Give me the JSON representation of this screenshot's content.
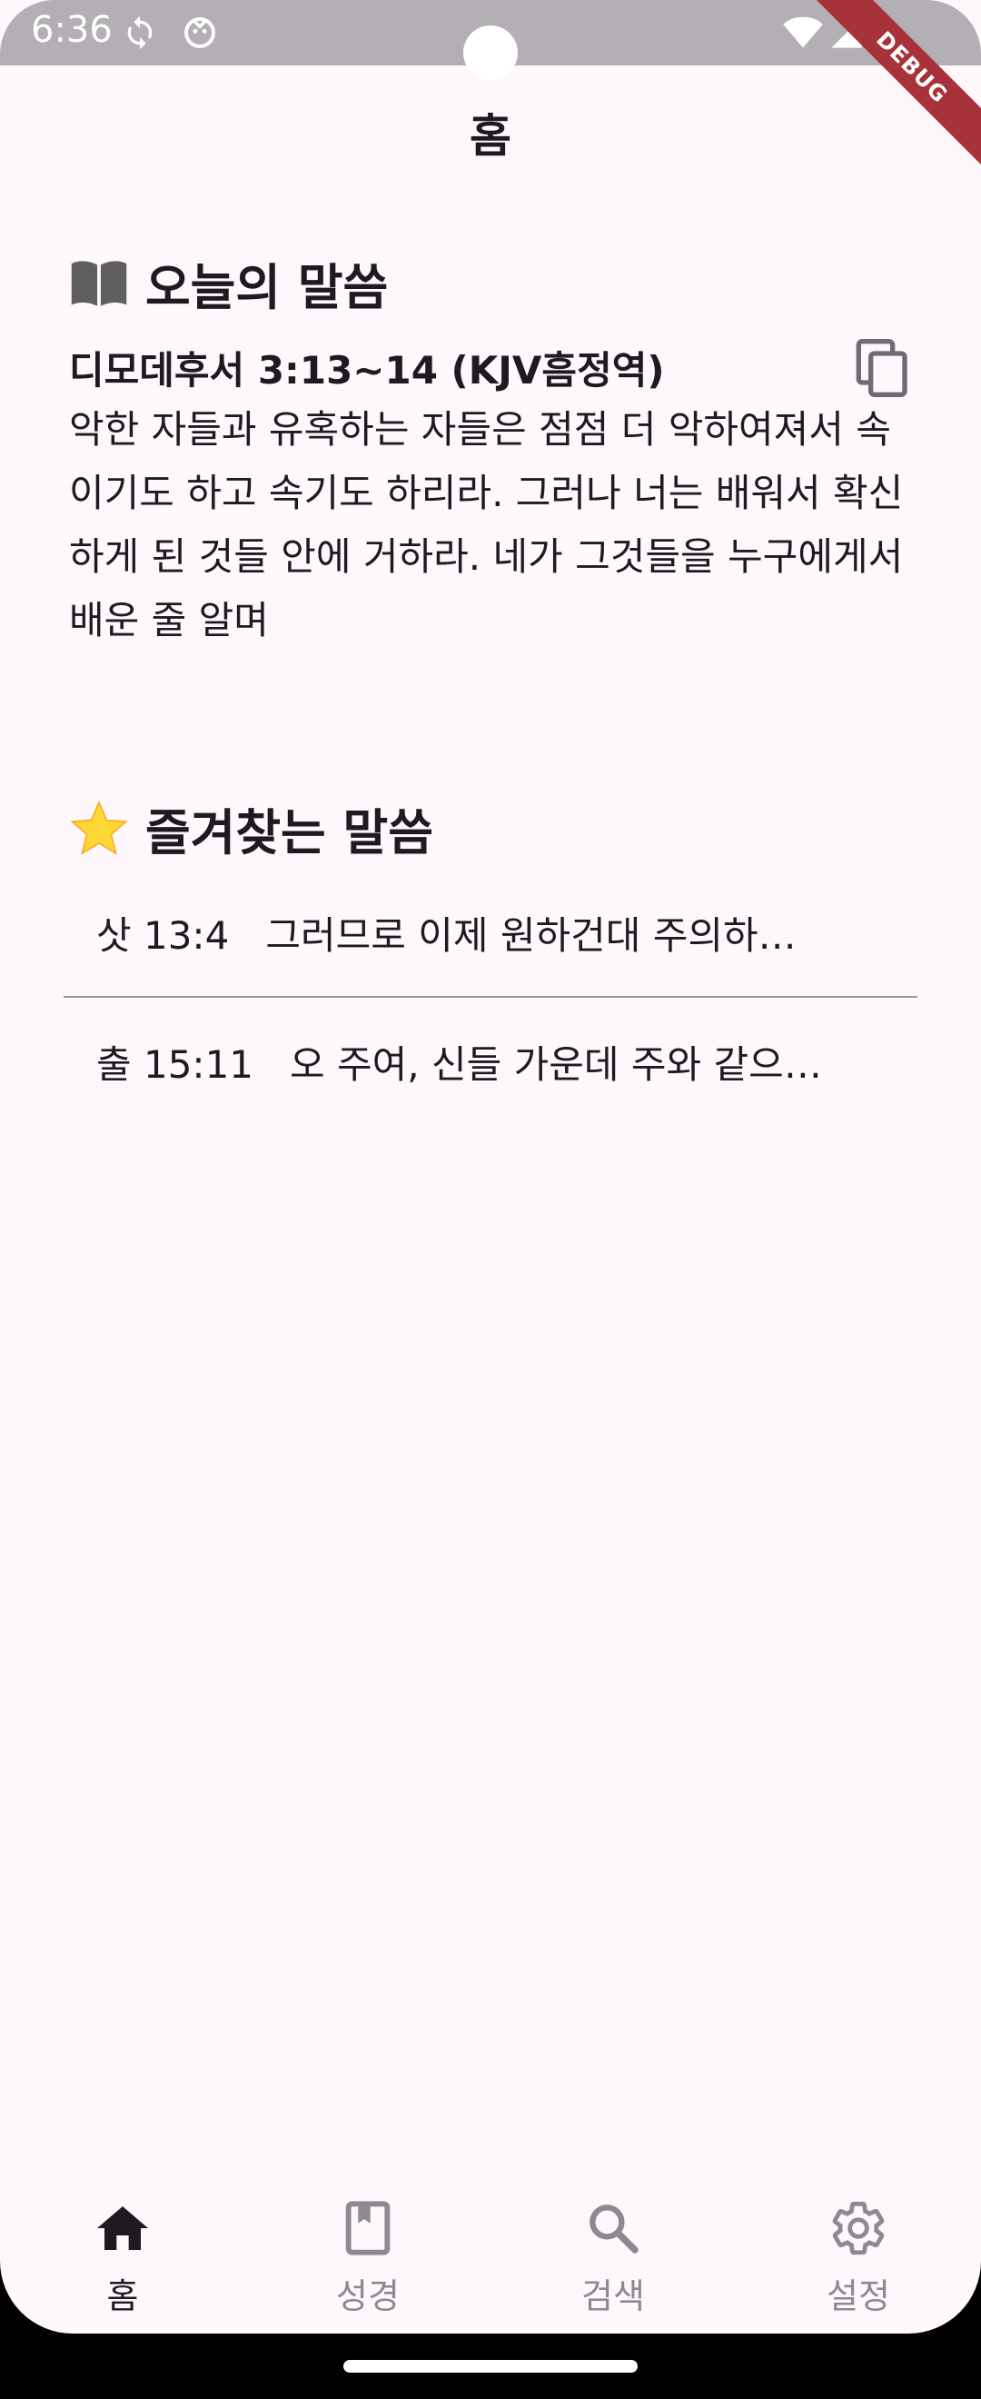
{
  "status_bar": {
    "time": "6:36",
    "debug_label": "DEBUG"
  },
  "app_bar": {
    "title": "홈"
  },
  "today_section": {
    "icon": "book-open-icon",
    "title": "오늘의 말씀",
    "reference": "디모데후서 3:13~14 (KJV흠정역)",
    "text": "악한 자들과 유혹하는 자들은 점점 더 악하여져서 속이기도 하고 속기도 하리라. 그러나 너는 배워서 확신하게 된 것들 안에 거하라. 네가 그것들을 누구에게서 배운 줄 알며"
  },
  "favorites_section": {
    "icon": "star-icon",
    "title": "즐겨찾는 말씀",
    "items": [
      {
        "ref": "삿 13:4",
        "text": "그러므로 이제 원하건대 주의하…"
      },
      {
        "ref": "출 15:11",
        "text": "오 주여, 신들 가운데 주와 같으…"
      }
    ]
  },
  "bottom_nav": {
    "items": [
      {
        "label": "홈",
        "icon": "home-icon",
        "active": true
      },
      {
        "label": "성경",
        "icon": "bible-icon",
        "active": false
      },
      {
        "label": "검색",
        "icon": "search-icon",
        "active": false
      },
      {
        "label": "설정",
        "icon": "gear-icon",
        "active": false
      }
    ]
  },
  "colors": {
    "background": "#fef7fb",
    "text": "#1d1b20",
    "inactive": "#8d8990",
    "star": "#fdd835"
  }
}
